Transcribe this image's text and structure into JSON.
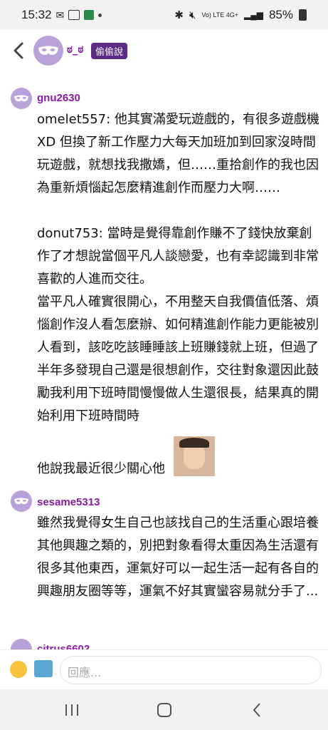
{
  "status_bar": {
    "time": "15:32",
    "network": "Vo) LTE 4G+",
    "battery": "85%"
  },
  "header": {
    "name": "ಠ_ಠ",
    "badge": "偷偷說"
  },
  "comments": [
    {
      "username": "gnu2630",
      "paragraphs": [
        "omelet557: 他其實滿愛玩遊戲的，有很多遊戲機XD 但換了新工作壓力大每天加班加到回家沒時間玩遊戲，就想找我撒嬌，但……重拾創作的我也因為重新煩惱起怎麼精進創作而壓力大啊……",
        "donut753: 當時是覺得靠創作賺不了錢快放棄創作了才想說當個平凡人談戀愛，也有幸認識到非常喜歡的人進而交往。",
        "當平凡人確實很開心，不用整天自我價值低落、煩惱創作沒人看怎麼辦、如何精進創作能力更能被別人看到，該吃吃該睡睡該上班賺錢就上班，但過了半年多發現自己還是很想創作，交往對象還因此鼓勵我利用下班時間慢慢做人生還很長，結果真的開始利用下班時間時",
        "他說我最近很少關心他"
      ]
    },
    {
      "username": "sesame5313",
      "paragraphs": [
        "雖然我覺得女生自己也該找自己的生活重心跟培養其他興趣之類的，別把對象看得太重因為生活還有很多其他東西，運氣好可以一起生活一起有各自的興趣朋友圈等等，運氣不好其實蠻容易就分手了..."
      ]
    },
    {
      "username": "citrus6602"
    }
  ],
  "input": {
    "placeholder": "回應..."
  },
  "colors": {
    "username": "#8a1aa8",
    "badge_bg": "#5b2b86",
    "avatar_bg": "#b8a2d9"
  }
}
